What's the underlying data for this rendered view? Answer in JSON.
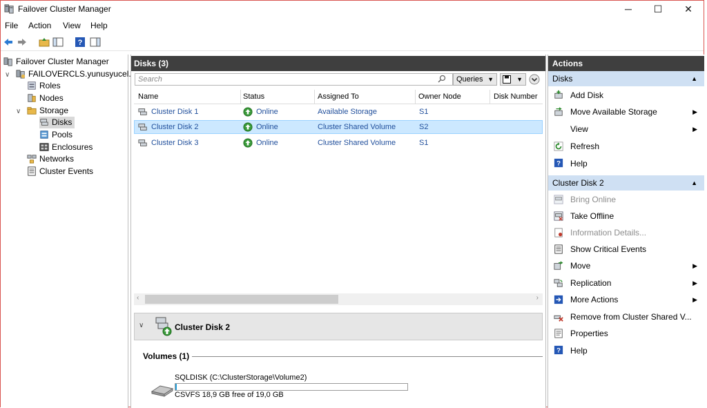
{
  "window": {
    "title": "Failover Cluster Manager",
    "minimize_glyph": "─",
    "maximize_glyph": "☐",
    "close_glyph": "✕"
  },
  "menu": [
    "File",
    "Action",
    "View",
    "Help"
  ],
  "tree": {
    "root": "Failover Cluster Manager",
    "cluster": "FAILOVERCLS.yunusyucel.c",
    "roles": "Roles",
    "nodes": "Nodes",
    "storage": "Storage",
    "disks": "Disks",
    "pools": "Pools",
    "enclosures": "Enclosures",
    "networks": "Networks",
    "cluster_events": "Cluster Events"
  },
  "center": {
    "header": "Disks (3)",
    "search_placeholder": "Search",
    "queries_label": "Queries",
    "columns": [
      "Name",
      "Status",
      "Assigned To",
      "Owner Node",
      "Disk Number"
    ],
    "rows": [
      {
        "name": "Cluster Disk 1",
        "status": "Online",
        "assigned": "Available Storage",
        "owner": "S1"
      },
      {
        "name": "Cluster Disk 2",
        "status": "Online",
        "assigned": "Cluster Shared Volume",
        "owner": "S2"
      },
      {
        "name": "Cluster Disk 3",
        "status": "Online",
        "assigned": "Cluster Shared Volume",
        "owner": "S1"
      }
    ],
    "detail_title": "Cluster Disk 2",
    "volumes_label": "Volumes (1)",
    "volume_name": "SQLDISK (C:\\ClusterStorage\\Volume2)",
    "volume_info": "CSVFS 18,9 GB free of 19,0 GB",
    "volume_used_fraction": 0.005
  },
  "actions": {
    "header": "Actions",
    "disks_section": "Disks",
    "disks_items": [
      {
        "label": "Add Disk",
        "arrow": false
      },
      {
        "label": "Move Available Storage",
        "arrow": true
      },
      {
        "label": "View",
        "arrow": true
      },
      {
        "label": "Refresh",
        "arrow": false
      },
      {
        "label": "Help",
        "arrow": false
      }
    ],
    "disk2_section": "Cluster Disk 2",
    "disk2_items": [
      {
        "label": "Bring Online",
        "arrow": false,
        "disabled": true
      },
      {
        "label": "Take Offline",
        "arrow": false,
        "disabled": false
      },
      {
        "label": "Information Details...",
        "arrow": false,
        "disabled": true
      },
      {
        "label": "Show Critical Events",
        "arrow": false,
        "disabled": false
      },
      {
        "label": "Move",
        "arrow": true,
        "disabled": false
      },
      {
        "label": "Replication",
        "arrow": true,
        "disabled": false
      },
      {
        "label": "More Actions",
        "arrow": true,
        "disabled": false
      },
      {
        "label": "Remove from Cluster Shared V...",
        "arrow": false,
        "disabled": false
      },
      {
        "label": "Properties",
        "arrow": false,
        "disabled": false
      },
      {
        "label": "Help",
        "arrow": false,
        "disabled": false
      }
    ]
  },
  "colors": {
    "header_dark": "#3f3f3f",
    "section_blue": "#cfe0f3",
    "selected_row": "#cce8ff",
    "link_blue": "#1f4e9b",
    "online_green": "#3a9a3a"
  }
}
